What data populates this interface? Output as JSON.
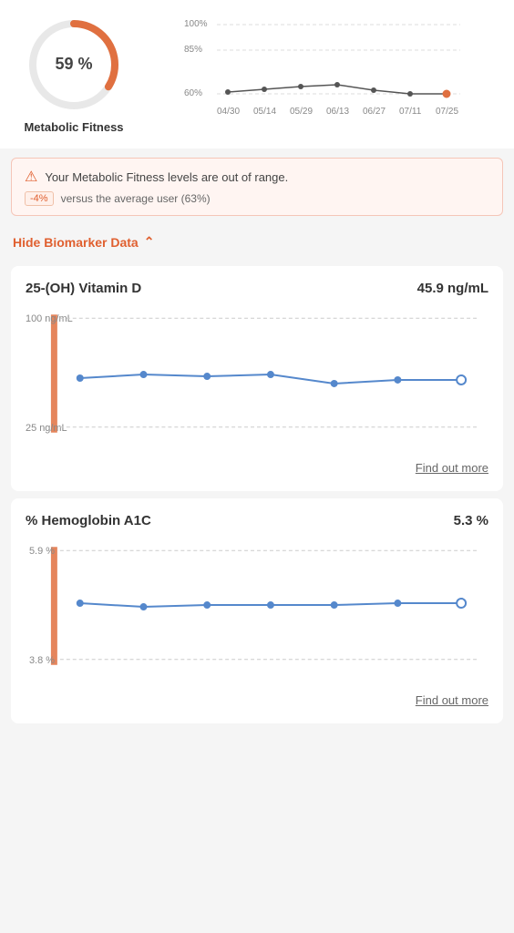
{
  "header": {
    "percentage": "59 %",
    "label": "Metabolic Fitness"
  },
  "alert": {
    "main_text": "Your Metabolic Fitness levels are out of range.",
    "sub_badge": "-4%",
    "sub_text": "versus the average user (63%)"
  },
  "hide_biomarker": {
    "label": "Hide Biomarker Data"
  },
  "biomarker1": {
    "title": "25-(OH) Vitamin D",
    "value": "45.9 ng/mL",
    "y_top": "100 ng/mL",
    "y_bottom": "25 ng/mL",
    "find_out_more": "Find out more"
  },
  "biomarker2": {
    "title": "% Hemoglobin A1C",
    "value": "5.3 %",
    "y_top": "5.9 %",
    "y_bottom": "3.8 %",
    "find_out_more": "Find out more"
  },
  "trend_chart": {
    "y_labels": [
      "100%",
      "85%",
      "60%"
    ],
    "x_labels": [
      "04/30",
      "05/14",
      "05/29",
      "06/13",
      "06/27",
      "07/11",
      "07/25"
    ]
  }
}
